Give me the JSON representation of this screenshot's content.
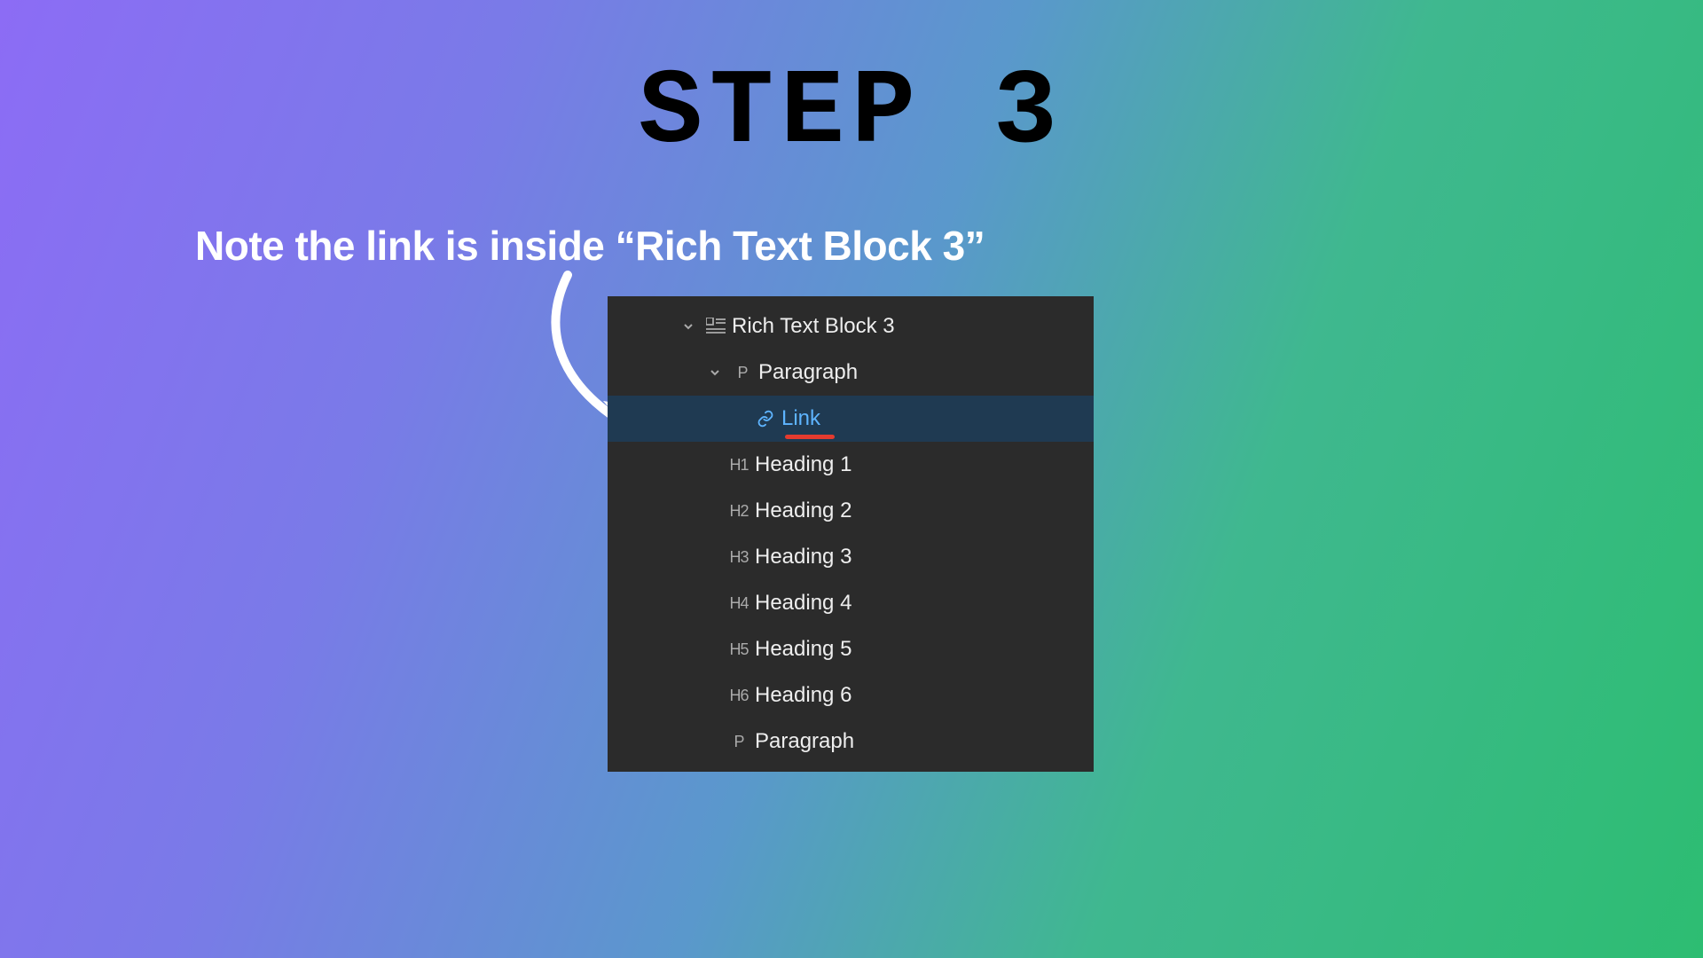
{
  "title": "STEP 3",
  "note": "Note the link is inside “Rich Text Block 3”",
  "panel": {
    "root": {
      "label": "Rich Text Block 3",
      "icon": "rich-text-block"
    },
    "paragraph": {
      "label": "Paragraph",
      "icon_text": "P"
    },
    "link": {
      "label": "Link",
      "icon": "link"
    },
    "siblings": [
      {
        "icon_text": "H1",
        "label": "Heading 1"
      },
      {
        "icon_text": "H2",
        "label": "Heading 2"
      },
      {
        "icon_text": "H3",
        "label": "Heading 3"
      },
      {
        "icon_text": "H4",
        "label": "Heading 4"
      },
      {
        "icon_text": "H5",
        "label": "Heading 5"
      },
      {
        "icon_text": "H6",
        "label": "Heading 6"
      },
      {
        "icon_text": "P",
        "label": "Paragraph"
      }
    ]
  }
}
